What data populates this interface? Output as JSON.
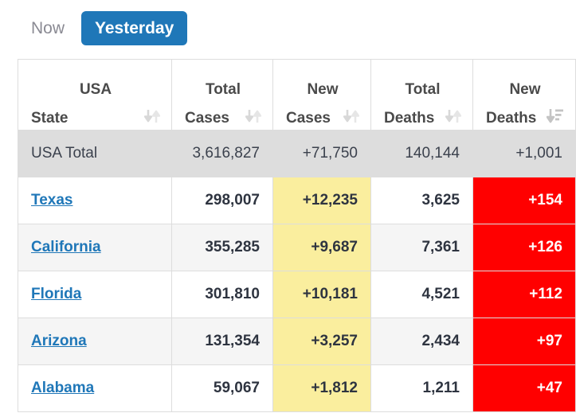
{
  "tabs": [
    {
      "label": "Now",
      "active": false,
      "name": "tab-now"
    },
    {
      "label": "Yesterday",
      "active": true,
      "name": "tab-yesterday"
    }
  ],
  "colors": {
    "accent_blue": "#1f77b8",
    "new_cases_bg": "#faee9e",
    "new_deaths_bg": "#ff0000",
    "total_row_bg": "#dddddd",
    "alt_row_bg": "#f5f5f5",
    "link": "#1f77b8",
    "header_text": "#4a4a4a"
  },
  "table": {
    "columns": [
      {
        "line1": "USA",
        "line2": "State",
        "sort_icon": "sort-both-icon",
        "sorted": false,
        "align": "left"
      },
      {
        "line1": "Total",
        "line2": "Cases",
        "sort_icon": "sort-both-icon",
        "sorted": false,
        "align": "right"
      },
      {
        "line1": "New",
        "line2": "Cases",
        "sort_icon": "sort-both-icon",
        "sorted": false,
        "align": "right"
      },
      {
        "line1": "Total",
        "line2": "Deaths",
        "sort_icon": "sort-both-icon",
        "sorted": false,
        "align": "right"
      },
      {
        "line1": "New",
        "line2": "Deaths",
        "sort_icon": "sort-descending-icon",
        "sorted": true,
        "align": "right"
      }
    ],
    "total_row": {
      "state": "USA Total",
      "total_cases": "3,616,827",
      "new_cases": "+71,750",
      "total_deaths": "140,144",
      "new_deaths": "+1,001"
    },
    "rows": [
      {
        "state": "Texas",
        "total_cases": "298,007",
        "new_cases": "+12,235",
        "total_deaths": "3,625",
        "new_deaths": "+154"
      },
      {
        "state": "California",
        "total_cases": "355,285",
        "new_cases": "+9,687",
        "total_deaths": "7,361",
        "new_deaths": "+126"
      },
      {
        "state": "Florida",
        "total_cases": "301,810",
        "new_cases": "+10,181",
        "total_deaths": "4,521",
        "new_deaths": "+112"
      },
      {
        "state": "Arizona",
        "total_cases": "131,354",
        "new_cases": "+3,257",
        "total_deaths": "2,434",
        "new_deaths": "+97"
      },
      {
        "state": "Alabama",
        "total_cases": "59,067",
        "new_cases": "+1,812",
        "total_deaths": "1,211",
        "new_deaths": "+47"
      }
    ]
  }
}
